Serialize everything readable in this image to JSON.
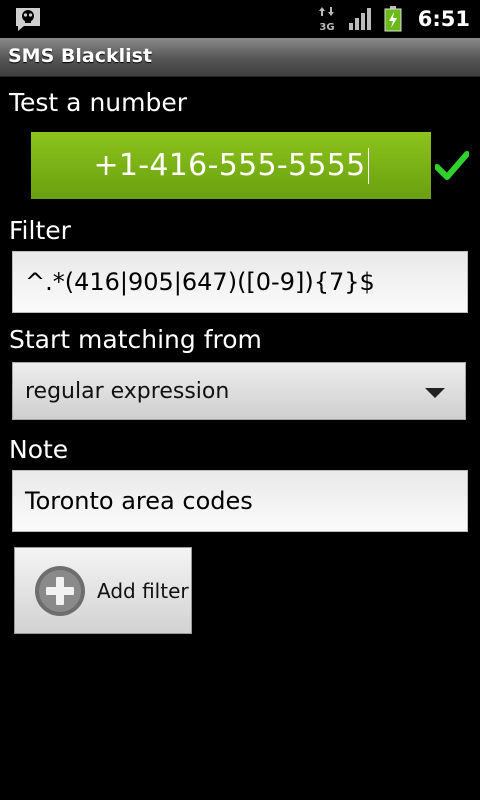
{
  "status_bar": {
    "time": "6:51",
    "network_label": "3G",
    "icons": [
      "notification-icon",
      "3g-data-icon",
      "signal-strength-icon",
      "battery-charging-icon"
    ]
  },
  "app": {
    "title": "SMS Blacklist"
  },
  "form": {
    "test_label": "Test a number",
    "test_value": "+1-416-555-5555",
    "filter_label": "Filter",
    "filter_value": "^.*(416|905|647)([0-9]){7}$",
    "match_label": "Start matching from",
    "match_selected": "regular expression",
    "note_label": "Note",
    "note_value": "Toronto area codes",
    "add_button_label": "Add filter"
  },
  "colors": {
    "accent_green": "#7ab317",
    "check_green": "#2fd12f",
    "background": "#000000"
  }
}
